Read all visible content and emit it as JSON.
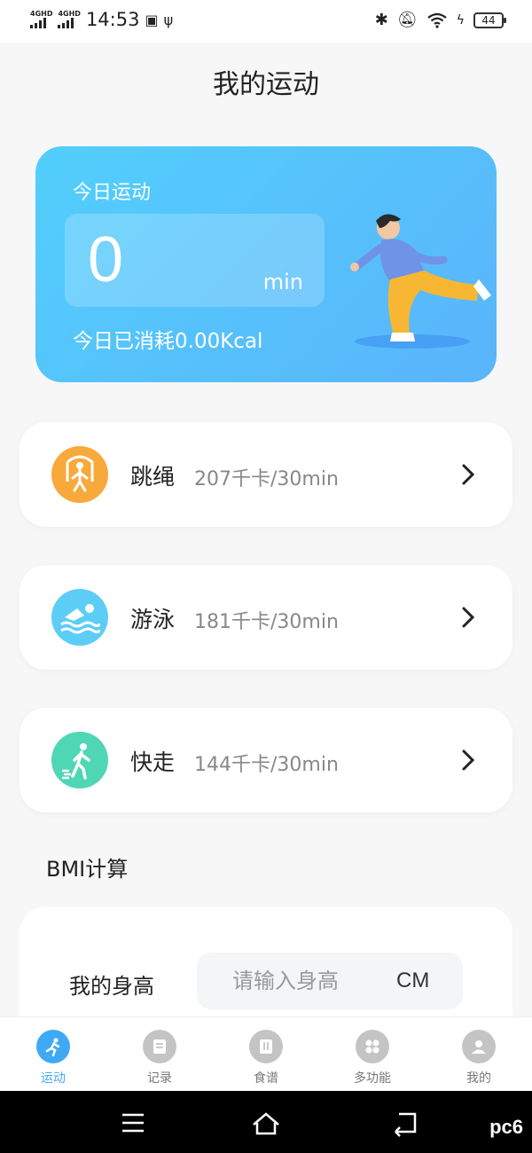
{
  "status_bar": {
    "network1": "4GHD",
    "network2": "4GHD",
    "time": "14:53",
    "battery": "44"
  },
  "page_title": "我的运动",
  "hero": {
    "label": "今日运动",
    "value": "0",
    "unit": "min",
    "kcal_text": "今日已消耗0.00Kcal"
  },
  "exercises": [
    {
      "name": "跳绳",
      "desc": "207千卡/30min",
      "icon": "jump-rope-icon",
      "color": "#f8a93b"
    },
    {
      "name": "游泳",
      "desc": "181千卡/30min",
      "icon": "swim-icon",
      "color": "#5ccdf7"
    },
    {
      "name": "快走",
      "desc": "144千卡/30min",
      "icon": "walk-icon",
      "color": "#4fd6b5"
    }
  ],
  "bmi": {
    "title": "BMI计算",
    "height_label": "我的身高",
    "height_placeholder": "请输入身高",
    "height_unit": "CM"
  },
  "tabs": [
    {
      "label": "运动",
      "icon": "run-icon",
      "active": true
    },
    {
      "label": "记录",
      "icon": "record-icon",
      "active": false
    },
    {
      "label": "食谱",
      "icon": "recipe-icon",
      "active": false
    },
    {
      "label": "多功能",
      "icon": "multi-function-icon",
      "active": false
    },
    {
      "label": "我的",
      "icon": "profile-icon",
      "active": false
    }
  ],
  "watermark": "pc6",
  "colors": {
    "accent": "#3fa9f5",
    "hero_start": "#52cffc",
    "hero_end": "#5ab4fb"
  }
}
